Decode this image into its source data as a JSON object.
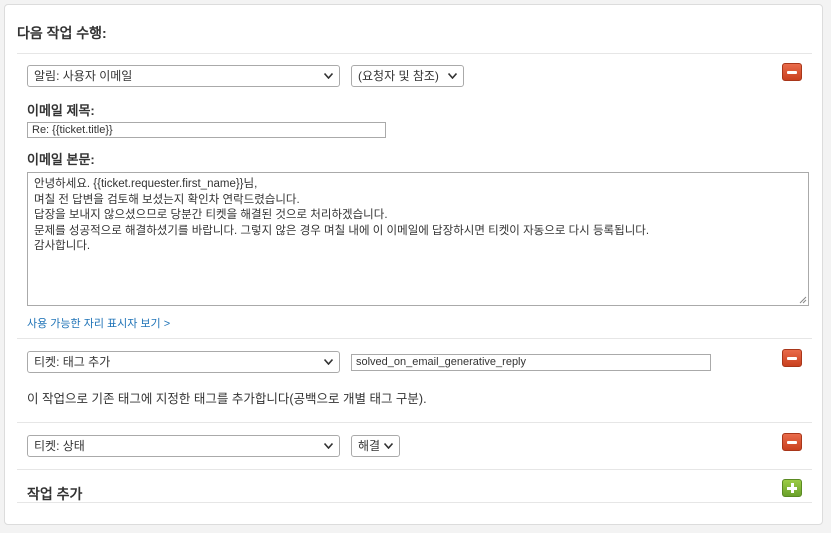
{
  "header": {
    "title": "다음 작업 수행:"
  },
  "actions": [
    {
      "type_value": "알림: 사용자 이메일",
      "recipient_value": "(요청자 및 참조)",
      "subject_label": "이메일 제목:",
      "subject_value": "Re: {{ticket.title}}",
      "body_label": "이메일 본문:",
      "body_lines": [
        "안녕하세요. {{ticket.requester.first_name}}님,",
        "며칠 전 답변을 검토해 보셨는지 확인차 연락드렸습니다.",
        "답장을 보내지 않으셨으므로 당분간 티켓을 해결된 것으로 처리하겠습니다.",
        "문제를 성공적으로 해결하셨기를 바랍니다. 그렇지 않은 경우 며칠 내에 이 이메일에 답장하시면 티켓이 자동으로 다시 등록됩니다.",
        "감사합니다."
      ],
      "placeholders_link": "사용 가능한 자리 표시자 보기 >"
    },
    {
      "type_value": "티켓: 태그 추가",
      "tag_value": "solved_on_email_generative_reply",
      "description": "이 작업으로 기존 태그에 지정한 태그를 추가합니다(공백으로 개별 태그 구분)."
    },
    {
      "type_value": "티켓: 상태",
      "status_value": "해결"
    }
  ],
  "footer": {
    "add_action_label": "작업 추가"
  },
  "colors": {
    "remove_button": "#d9532f",
    "add_button": "#7db538",
    "link": "#1f73b7"
  }
}
